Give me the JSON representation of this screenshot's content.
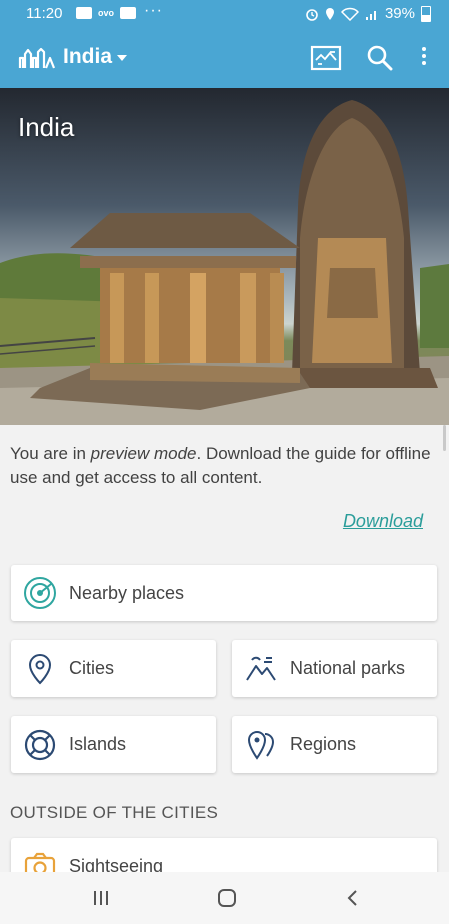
{
  "status_bar": {
    "time": "11:20",
    "notif_label": "ovo",
    "dots": "···",
    "battery": "39%"
  },
  "app_bar": {
    "title": "India",
    "brand_color": "#4aa6d3"
  },
  "hero": {
    "title": "India"
  },
  "preview": {
    "text_before": "You are in ",
    "text_em": "preview mode",
    "text_after": ". Download the guide for offline use and get access to all content.",
    "download_label": "Download"
  },
  "cards": {
    "nearby": "Nearby places",
    "cities": "Cities",
    "parks": "National parks",
    "islands": "Islands",
    "regions": "Regions"
  },
  "outside": {
    "title": "OUTSIDE OF THE CITIES",
    "sightseeing": "Sightseeing"
  },
  "icons": {
    "logo": "skyline-logo-icon",
    "map": "map-icon",
    "search": "search-icon",
    "menu": "overflow-menu-icon",
    "nearby": "radar-icon",
    "cities": "location-pin-icon",
    "parks": "mountain-icon",
    "islands": "lifebuoy-icon",
    "regions": "multi-pin-icon",
    "sights": "camera-icon"
  }
}
